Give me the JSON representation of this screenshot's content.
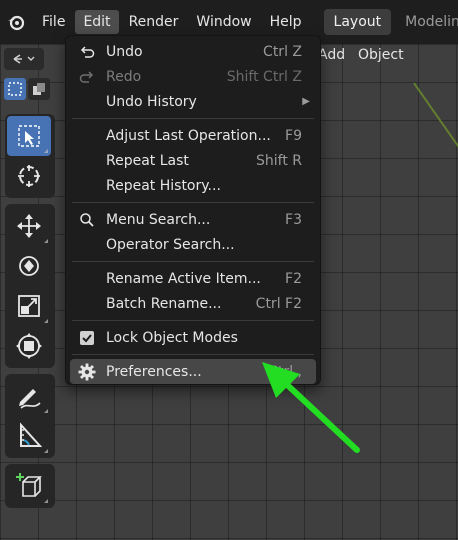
{
  "topbar": {
    "menus": [
      "File",
      "Edit",
      "Render",
      "Window",
      "Help"
    ],
    "workspaces": [
      "Layout",
      "Modeling"
    ]
  },
  "viewport_header": {
    "add_label": "Add",
    "object_label": "Object"
  },
  "edit_menu": {
    "items": [
      {
        "label": "Undo",
        "shortcut": "Ctrl Z"
      },
      {
        "label": "Redo",
        "shortcut": "Shift Ctrl Z"
      },
      {
        "label": "Undo History",
        "shortcut": ""
      },
      {
        "label": "Adjust Last Operation...",
        "shortcut": "F9"
      },
      {
        "label": "Repeat Last",
        "shortcut": "Shift R"
      },
      {
        "label": "Repeat History...",
        "shortcut": ""
      },
      {
        "label": "Menu Search...",
        "shortcut": "F3"
      },
      {
        "label": "Operator Search...",
        "shortcut": ""
      },
      {
        "label": "Rename Active Item...",
        "shortcut": "F2"
      },
      {
        "label": "Batch Rename...",
        "shortcut": "Ctrl F2"
      },
      {
        "label": "Lock Object Modes",
        "shortcut": ""
      },
      {
        "label": "Preferences...",
        "shortcut": "Ctrl ,"
      }
    ]
  },
  "colors": {
    "accent": "#4772b3",
    "annotation_arrow": "#22dd22"
  }
}
